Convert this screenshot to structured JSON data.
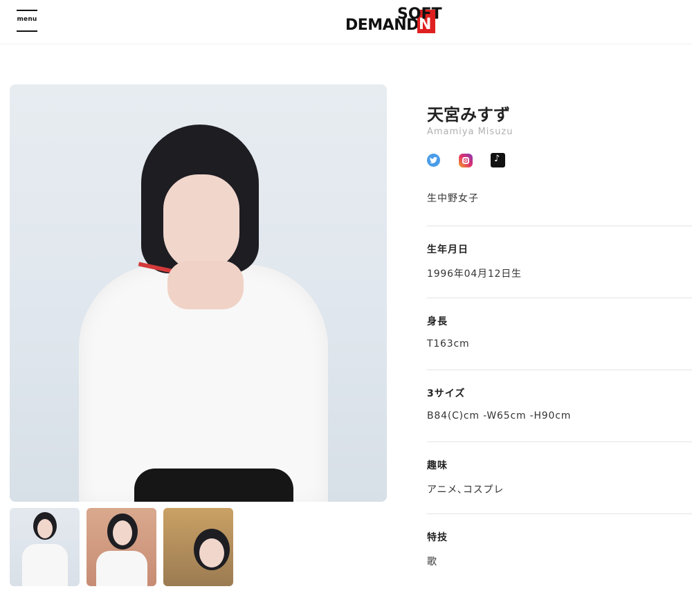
{
  "header": {
    "menu_label": "menu",
    "logo_top": "SOFT",
    "logo_bottom": "DEMAND",
    "logo_red": "N"
  },
  "gallery": {
    "thumbnail_count": 3
  },
  "profile": {
    "name": "天宮みすず",
    "romaji": "Amamiya Misuzu",
    "socials": [
      {
        "icon": "twitter-icon",
        "color": "#4a9ce8"
      },
      {
        "icon": "instagram-icon",
        "color": "#e1306c"
      },
      {
        "icon": "tiktok-icon",
        "color": "#111111"
      }
    ],
    "birthplace": "生中野女子",
    "info": [
      {
        "label": "生年月日",
        "value": "1996年04月12日生"
      },
      {
        "label": "身長",
        "value": "T163cm"
      },
      {
        "label": "3サイズ",
        "value": "B84(C)cm -W65cm -H90cm"
      },
      {
        "label": "趣味",
        "value": "アニメ､コスプレ"
      },
      {
        "label": "特技",
        "value": "歌"
      }
    ]
  }
}
